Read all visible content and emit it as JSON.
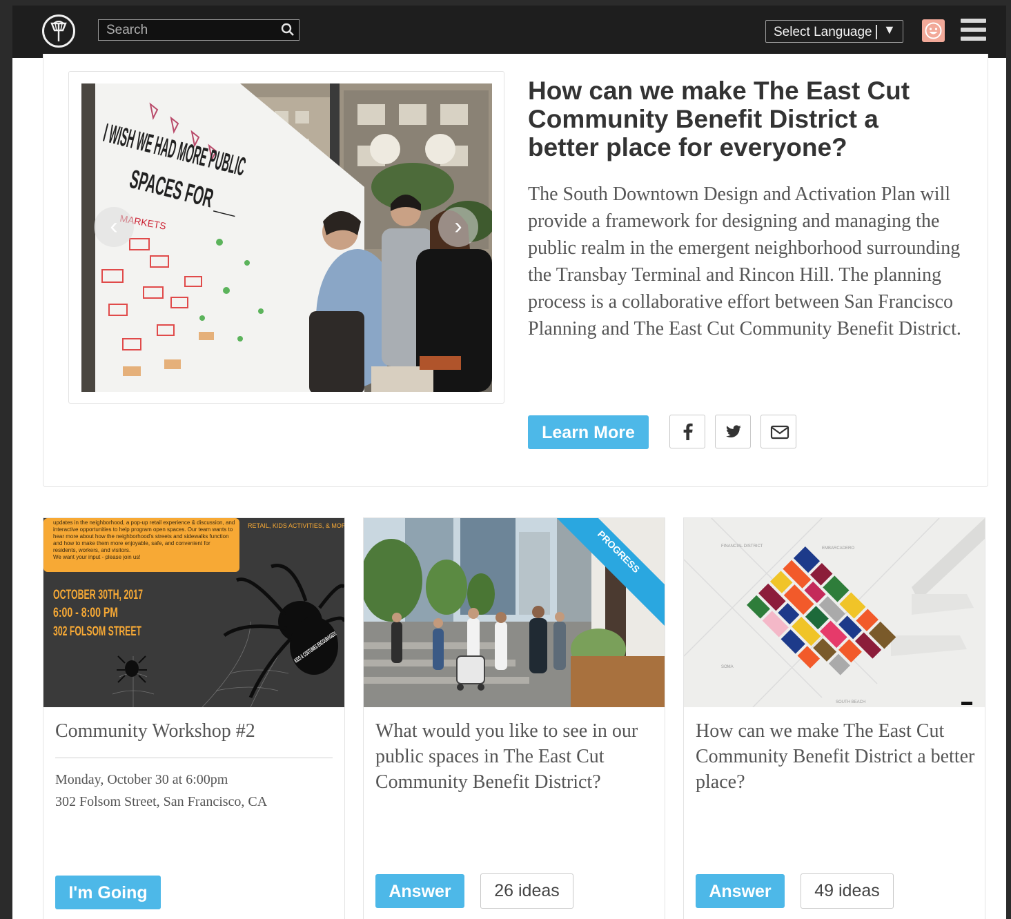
{
  "header": {
    "search_placeholder": "Search",
    "language_label": "Select Language",
    "logo_icon": "lamp-post-logo-icon",
    "avatar_icon": "smiley-avatar-icon",
    "menu_icon": "hamburger-menu-icon"
  },
  "hero": {
    "image_text": {
      "line1": "I WISH WE HAD MORE PUBLIC",
      "line2": "SPACES FOR ___",
      "board_word": "MARKETS"
    },
    "title": "How can we make The East Cut Community Benefit District a better place for everyone?",
    "description": "The South Downtown Design and Activation Plan will provide a framework for designing and managing the public realm in the emergent neighborhood surrounding the Transbay Terminal and Rincon Hill. The planning process is a collaborative effort between San Francisco Planning and The East Cut Community Benefit District.",
    "learn_more_label": "Learn More",
    "share_icons": [
      "facebook-icon",
      "twitter-icon",
      "email-icon"
    ]
  },
  "cards": [
    {
      "flyer": {
        "top_text": "updates in the neighborhood, a pop-up retail experience & discussion, and interactive opportunities to help program open spaces. Our team wants to hear more about how the neighborhood's streets and sidewalks function and how to make them more enjoyable, safe, and convenient for residents, workers, and visitors.",
        "top_text_2": "We want your input - please join us!",
        "tag": "RETAIL, KIDS ACTIVITIES, & MORE",
        "date": "OCTOBER 30TH, 2017",
        "time": "6:00 - 8:00 PM",
        "place": "302 FOLSOM STREET",
        "sticker": "KIDS & COSTUMES ENCOURAGED!"
      },
      "title": "Community Workshop #2",
      "date_line": "Monday, October 30 at 6:00pm",
      "address": "302 Folsom Street, San Francisco, CA",
      "button_label": "I'm Going"
    },
    {
      "ribbon": "PROGRESS",
      "title": "What would you like to see in our public spaces in The East Cut Community Benefit District?",
      "button_label": "Answer",
      "ideas_label": "26 ideas"
    },
    {
      "map_labels": [
        "FINANCIAL DISTRICT",
        "EMBARCADERO",
        "SOMA",
        "SOUTH BEACH"
      ],
      "title": "How can we make The East Cut Community Benefit District a better place?",
      "button_label": "Answer",
      "ideas_label": "49 ideas"
    }
  ],
  "colors": {
    "accent_button": "#4db8e8",
    "header_bg": "#1e1e1e",
    "flyer_orange": "#f7a935",
    "ribbon_blue": "#2aa7e0"
  }
}
